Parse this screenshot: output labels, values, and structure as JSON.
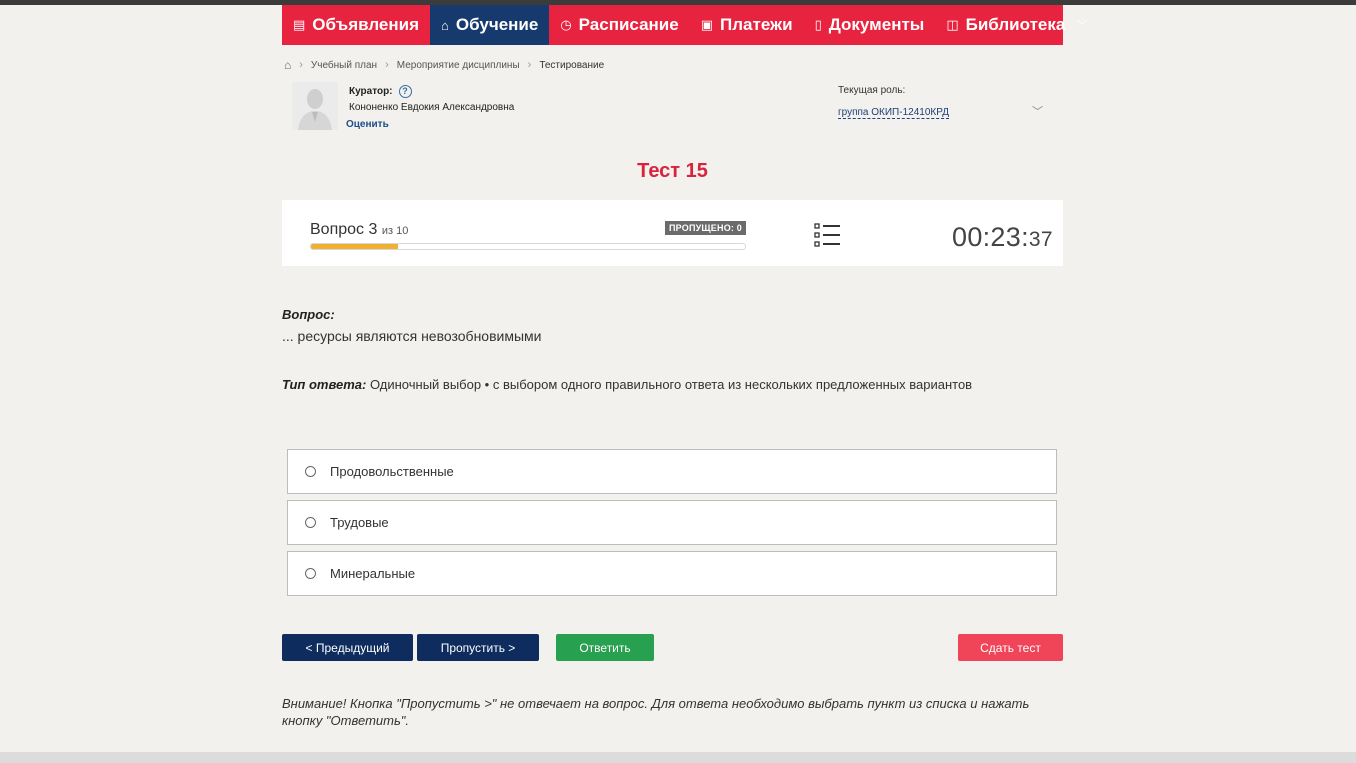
{
  "nav": {
    "items": [
      {
        "label": "Объявления",
        "icon": "newspaper-icon",
        "active": false
      },
      {
        "label": "Обучение",
        "icon": "graduation-cap-icon",
        "active": true
      },
      {
        "label": "Расписание",
        "icon": "clock-icon",
        "active": false
      },
      {
        "label": "Платежи",
        "icon": "money-icon",
        "active": false
      },
      {
        "label": "Документы",
        "icon": "document-icon",
        "active": false
      },
      {
        "label": "Библиотека",
        "icon": "book-icon",
        "active": false,
        "dropdown": true
      }
    ],
    "colors": {
      "bar": "#e8233f",
      "active": "#163a6e"
    }
  },
  "breadcrumb": {
    "home_icon": "home-icon",
    "items": [
      "Учебный план",
      "Мероприятие дисциплины",
      "Тестирование"
    ]
  },
  "curator": {
    "label": "Куратор:",
    "name": "Кононенко Евдокия Александровна",
    "rate_link": "Оценить"
  },
  "role": {
    "label": "Текущая роль:",
    "value": "группа ОКИП-12410КРД"
  },
  "test": {
    "title": "Тест 15",
    "question_word": "Вопрос",
    "question_number": "3",
    "question_of": "из 10",
    "current": 3,
    "total": 10,
    "progress_fraction": 0.2,
    "skipped_badge": "ПРОПУЩЕНО: 0",
    "timer_main": "00:23:",
    "timer_sec": "37"
  },
  "question": {
    "label": "Вопрос:",
    "text": "... ресурсы являются невозобновимыми",
    "type_label": "Тип ответа:",
    "type_value": " Одиночный выбор • с выбором одного правильного ответа из нескольких предложенных вариантов"
  },
  "options": [
    {
      "label": "Продовольственные"
    },
    {
      "label": "Трудовые"
    },
    {
      "label": "Минеральные"
    }
  ],
  "buttons": {
    "prev": "< Предыдущий",
    "skip": "Пропустить >",
    "answer": "Ответить",
    "submit": "Сдать тест"
  },
  "warning": "Внимание! Кнопка \"Пропустить >\" не отвечает на вопрос. Для ответа необходимо выбрать пункт из списка и нажать кнопку \"Ответить\"."
}
